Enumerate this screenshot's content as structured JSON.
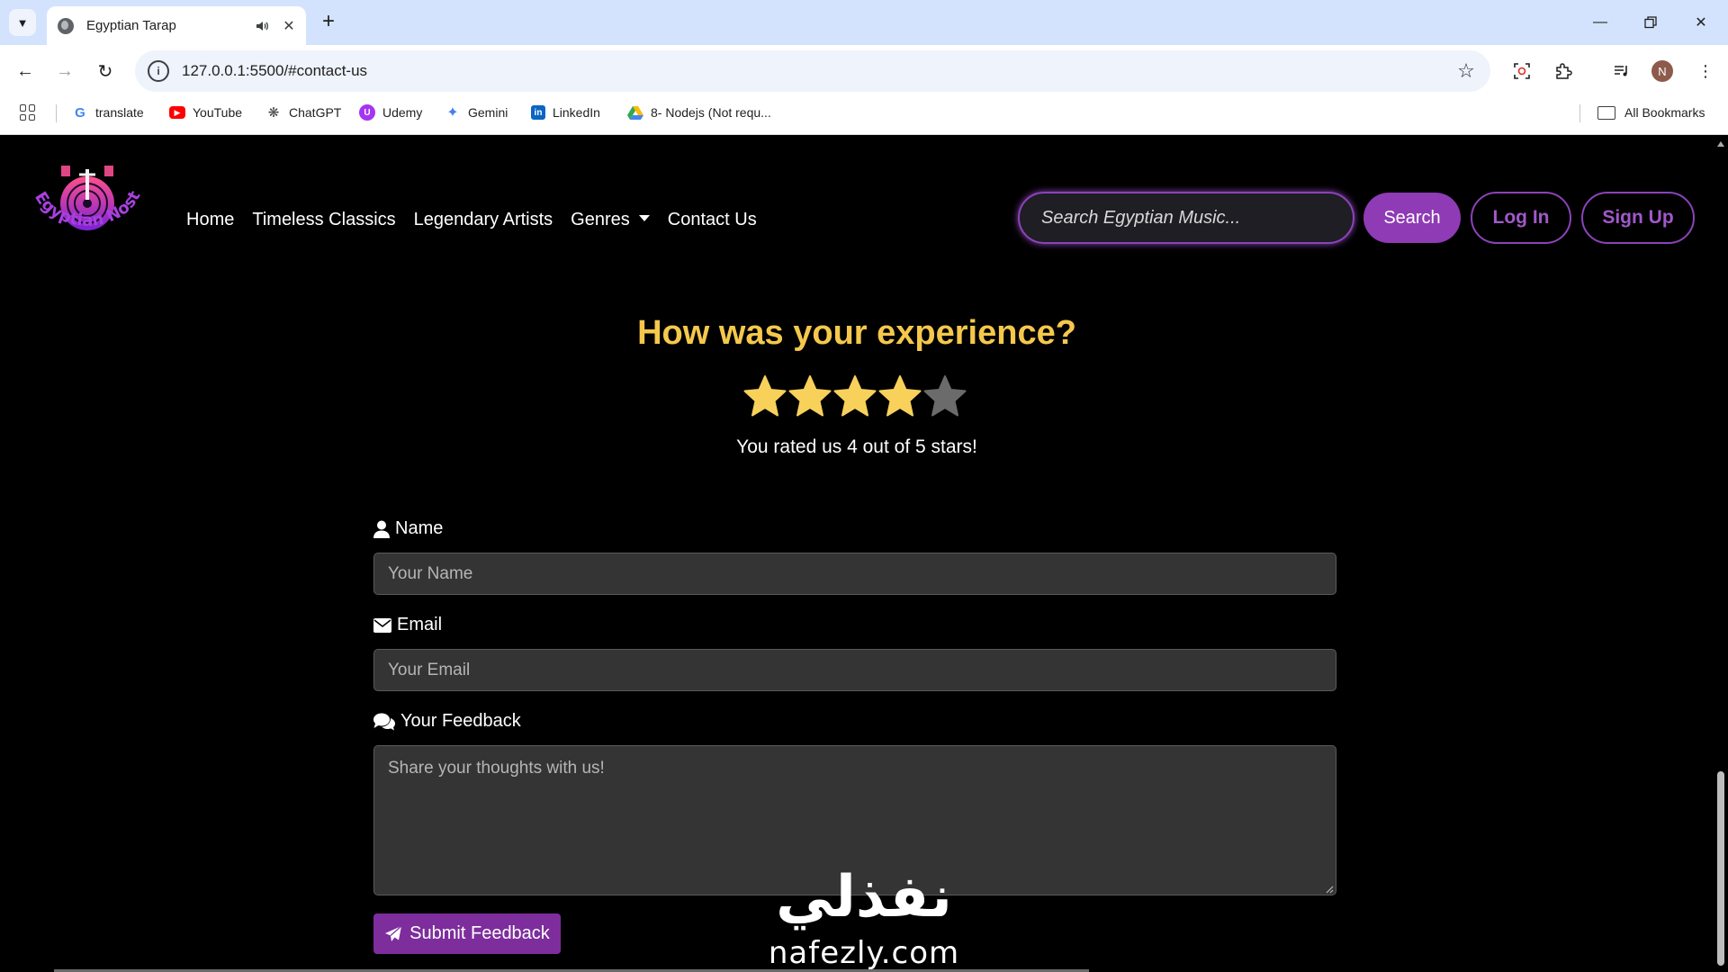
{
  "browser": {
    "tab_title": "Egyptian Tarap",
    "url": "127.0.0.1:5500/#contact-us",
    "profile_initial": "N",
    "bookmarks": [
      {
        "label": "translate",
        "icon": "google-icon"
      },
      {
        "label": "YouTube",
        "icon": "youtube-icon"
      },
      {
        "label": "ChatGPT",
        "icon": "chatgpt-icon"
      },
      {
        "label": "Udemy",
        "icon": "udemy-icon"
      },
      {
        "label": "Gemini",
        "icon": "gemini-icon"
      },
      {
        "label": "LinkedIn",
        "icon": "linkedin-icon"
      },
      {
        "label": "8- Nodejs (Not requ...",
        "icon": "drive-icon"
      }
    ],
    "all_bookmarks_label": "All Bookmarks"
  },
  "site": {
    "logo_text": "Egyptian Nostalgia",
    "nav": {
      "home": "Home",
      "classics": "Timeless Classics",
      "artists": "Legendary Artists",
      "genres": "Genres",
      "contact": "Contact Us"
    },
    "search": {
      "placeholder": "Search Egyptian Music...",
      "button": "Search"
    },
    "login": "Log In",
    "signup": "Sign Up"
  },
  "rating": {
    "title": "How was your experience?",
    "value": 4,
    "max": 5,
    "message": "You rated us 4 out of 5 stars!"
  },
  "form": {
    "name_label": "Name",
    "name_placeholder": "Your Name",
    "email_label": "Email",
    "email_placeholder": "Your Email",
    "feedback_label": "Your Feedback",
    "feedback_placeholder": "Share your thoughts with us!",
    "submit_label": "Submit Feedback"
  },
  "watermark": {
    "arabic": "نفذلي",
    "latin": "nafezly.com"
  },
  "colors": {
    "accent": "#8e3bb5",
    "gold": "#f5c84c",
    "star_on": "#f8d15a",
    "star_off": "#6b6b6b"
  }
}
